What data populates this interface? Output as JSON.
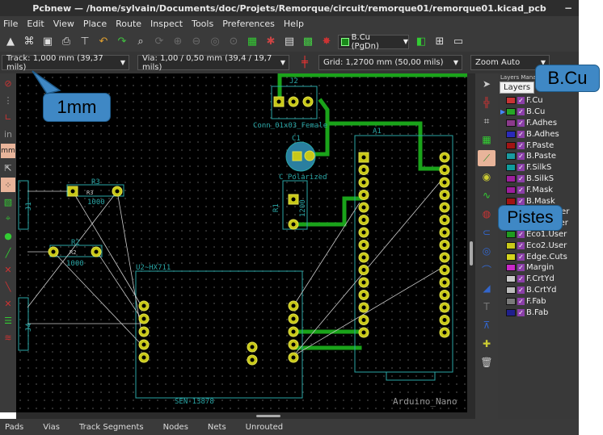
{
  "window": {
    "title": "Pcbnew — /home/sylvain/Documents/doc/Projets/Remorque/circuit/remorque01/remorque01.kicad_pcb",
    "minimize": "−"
  },
  "menu": [
    "File",
    "Edit",
    "View",
    "Place",
    "Route",
    "Inspect",
    "Tools",
    "Preferences",
    "Help"
  ],
  "toolbar": {
    "layer_select": "B.Cu (PgDn)"
  },
  "options": {
    "track": "Track: 1,000 mm (39,37 mils)",
    "via": "Via: 1,00 / 0,50 mm (39,4 / 19,7 mils)",
    "grid": "Grid: 1,2700 mm (50,00 mils)",
    "zoom": "Zoom Auto"
  },
  "layers_panel": {
    "header": "Layers Manager",
    "tab_layers": "Layers",
    "items": [
      {
        "name": "F.Cu",
        "color": "#c83434"
      },
      {
        "name": "B.Cu",
        "color": "#26a626"
      },
      {
        "name": "F.Adhes",
        "color": "#8b3a8b"
      },
      {
        "name": "B.Adhes",
        "color": "#2a2ab8"
      },
      {
        "name": "F.Paste",
        "color": "#a01414"
      },
      {
        "name": "B.Paste",
        "color": "#1a9aa0"
      },
      {
        "name": "F.SilkS",
        "color": "#0f9c9c"
      },
      {
        "name": "B.SilkS",
        "color": "#9c1f9c"
      },
      {
        "name": "F.Mask",
        "color": "#9c1f9c"
      },
      {
        "name": "B.Mask",
        "color": "#a01414"
      },
      {
        "name": "Dwgs.User",
        "color": "#b0b0b0"
      },
      {
        "name": "Cmts.User",
        "color": "#2a2ab8"
      },
      {
        "name": "Eco1.User",
        "color": "#1f9a1f"
      },
      {
        "name": "Eco2.User",
        "color": "#c8c81a"
      },
      {
        "name": "Edge.Cuts",
        "color": "#d4d41e"
      },
      {
        "name": "Margin",
        "color": "#c828c8"
      },
      {
        "name": "F.CrtYd",
        "color": "#c8c8c8"
      },
      {
        "name": "B.CrtYd",
        "color": "#bcbcbc"
      },
      {
        "name": "F.Fab",
        "color": "#7a7a7a"
      },
      {
        "name": "B.Fab",
        "color": "#20208c"
      }
    ]
  },
  "status": [
    "Pads",
    "Vias",
    "Track Segments",
    "Nodes",
    "Nets",
    "Unrouted"
  ],
  "pcb": {
    "labels": {
      "j_ref": "J2",
      "j_val": "Conn_01x03_Female",
      "c1_ref": "C1",
      "c1_val": "C_Polarized",
      "a1": "A1",
      "r1": "R1",
      "r1_val": "1200",
      "r3": "R3",
      "r3_val": "1000",
      "r2": "R2",
      "r2_val": "1000",
      "r2_top": "R2",
      "j1": "J1",
      "u2": "U2~HX711",
      "sen": "SEN-13878",
      "arduino": "Arduino_Nano",
      "j4": "J4"
    }
  },
  "annotations": {
    "track_note": "1mm",
    "layer_note": "B.Cu",
    "tool_note": "Pistes"
  }
}
